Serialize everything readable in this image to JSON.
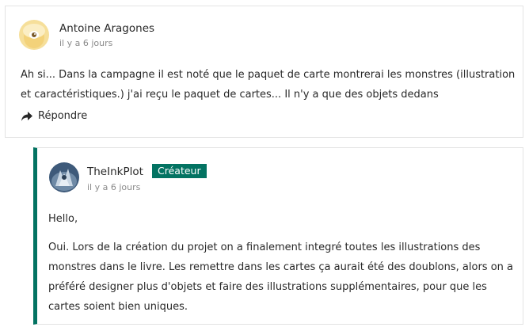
{
  "comments": [
    {
      "author": "Antoine Aragones",
      "time": "il y a 6 jours",
      "paragraphs": [
        "Ah si... Dans la campagne il est noté que le paquet de carte montrerai les monstres (illustration et caractéristiques.) j'ai reçu le paquet de cartes... Il n'y a que des objets dedans"
      ],
      "reply_label": "Répondre"
    },
    {
      "author": "TheInkPlot",
      "badge": "Créateur",
      "time": "il y a 6 jours",
      "paragraphs": [
        "Hello,",
        "Oui. Lors de la création du projet on a finalement integré toutes les illustrations des monstres dans le livre. Les remettre dans les cartes ça aurait été des doublons, alors on a préféré designer plus d'objets et faire des illustrations supplémentaires, pour que les cartes soient bien uniques."
      ]
    }
  ],
  "colors": {
    "accent": "#037362",
    "text": "#282828",
    "muted": "#8a8a8a",
    "border": "#e3e3e3"
  },
  "icons": {
    "reply": "reply-arrow-icon"
  }
}
